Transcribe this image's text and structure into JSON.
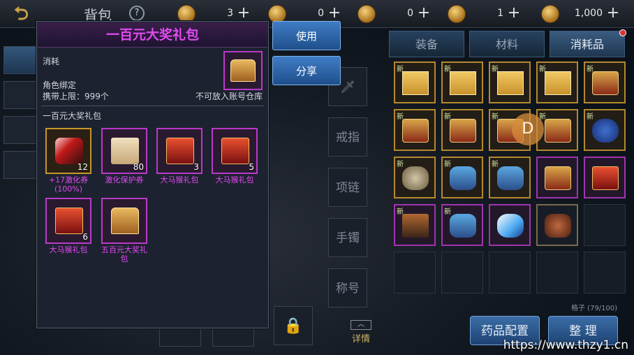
{
  "topbar": {
    "title": "背包",
    "help": "?",
    "currencies": [
      {
        "icon": "gold-coin-icon",
        "value": "3"
      },
      {
        "icon": "scroll-icon",
        "value": "0"
      },
      {
        "icon": "ticket-icon",
        "value": "0"
      },
      {
        "icon": "token-icon",
        "value": "1"
      },
      {
        "icon": "bound-gold-icon",
        "value": "1,000"
      }
    ]
  },
  "right_tabs": [
    "装备",
    "材料",
    "消耗品"
  ],
  "slots": [
    "戒指",
    "项链",
    "手镯",
    "称号"
  ],
  "grid": {
    "new_label": "新",
    "count": "格子 (79/100)"
  },
  "d_badge": "D",
  "buttons": {
    "use": "使用",
    "share": "分享",
    "potion_config": "药品配置",
    "organize": "整 理",
    "detail": "详情"
  },
  "popup": {
    "title": "一百元大奖礼包",
    "category": "消耗",
    "binding": "角色绑定",
    "carry_limit": "携带上限：999个",
    "storage_note": "不可放入账号仓库",
    "section": "一百元大奖礼包",
    "rewards": [
      {
        "name": "+17激化券(100%)",
        "count": "12",
        "art": "sword"
      },
      {
        "name": "激化保护券",
        "count": "80",
        "art": "scroll"
      },
      {
        "name": "大马猴礼包",
        "count": "3",
        "art": "redbox"
      },
      {
        "name": "大马猴礼包",
        "count": "5",
        "art": "redbox"
      },
      {
        "name": "大马猴礼包",
        "count": "6",
        "art": "redbox"
      },
      {
        "name": "五百元大奖礼包",
        "count": "",
        "art": "chest"
      }
    ]
  },
  "watermark": "https://www.thzy1.cn",
  "colors": {
    "accent_purple": "#e04af0",
    "button_blue": "#3f7cc4",
    "gold_border": "#b4892c"
  }
}
